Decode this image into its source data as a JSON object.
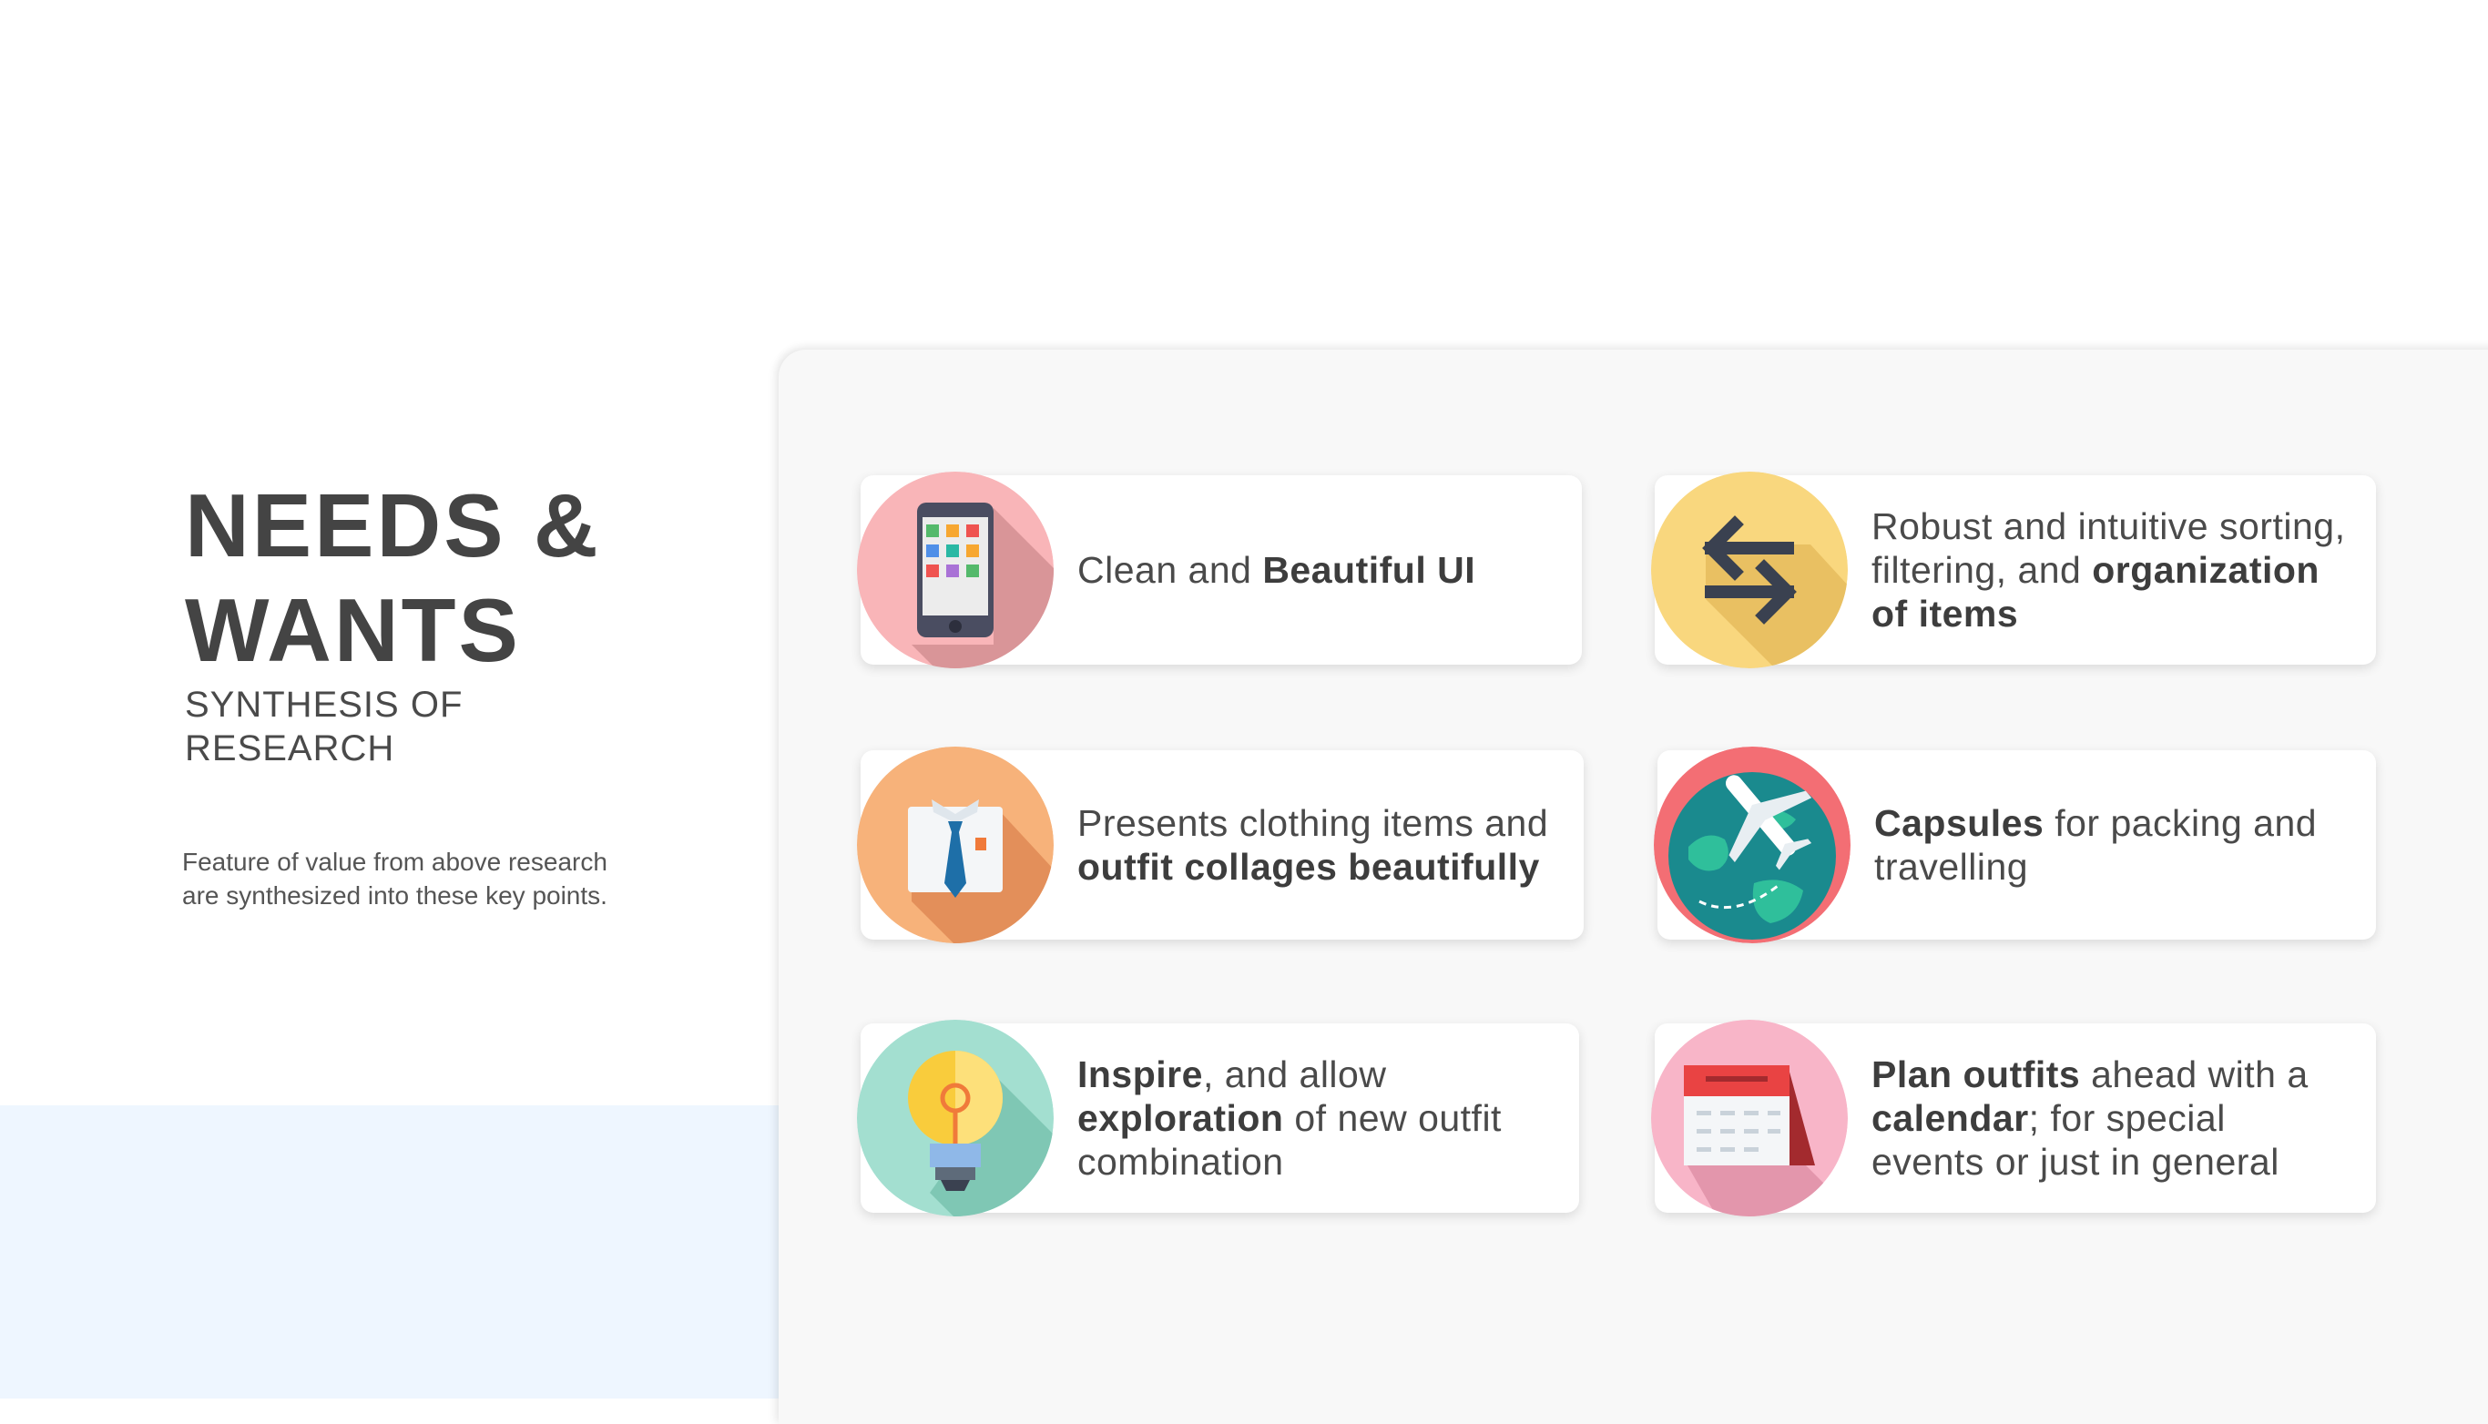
{
  "heading": {
    "line1": "NEEDS &",
    "line2": "WANTS"
  },
  "subheading": {
    "line1": "SYNTHESIS OF",
    "line2": "RESEARCH"
  },
  "description": {
    "line1": "Feature of value from above research",
    "line2": "are synthesized into these key points."
  },
  "cards": [
    {
      "icon": "smartphone-icon",
      "parts": [
        {
          "t": "Clean and "
        },
        {
          "b": "Beautiful UI"
        }
      ]
    },
    {
      "icon": "swap-arrows-icon",
      "parts": [
        {
          "t": "Robust and intuitive sorting, filtering, and "
        },
        {
          "b": "organization of items"
        }
      ]
    },
    {
      "icon": "shirt-tie-icon",
      "parts": [
        {
          "t": "Presents clothing items and "
        },
        {
          "b": "outfit collages beautifully"
        }
      ]
    },
    {
      "icon": "globe-plane-icon",
      "parts": [
        {
          "b": "Capsules"
        },
        {
          "t": " for packing and travelling"
        }
      ]
    },
    {
      "icon": "lightbulb-icon",
      "parts": [
        {
          "b": "Inspire"
        },
        {
          "t": ", and allow "
        },
        {
          "b": "exploration"
        },
        {
          "t": " of new outfit combination"
        }
      ]
    },
    {
      "icon": "calendar-icon",
      "parts": [
        {
          "b": "Plan outfits"
        },
        {
          "t": " ahead with a "
        },
        {
          "b": "calendar"
        },
        {
          "t": "; for special events or just in general"
        }
      ]
    }
  ],
  "colors": {
    "panel": "#f8f8f8",
    "blue_band": "#eef6ff",
    "pink": "#f9b5b8",
    "yellow": "#f9d77e",
    "orange": "#f7b27a",
    "coral": "#f36e74",
    "mint": "#a3dfd0",
    "rose": "#f8b5c8"
  }
}
